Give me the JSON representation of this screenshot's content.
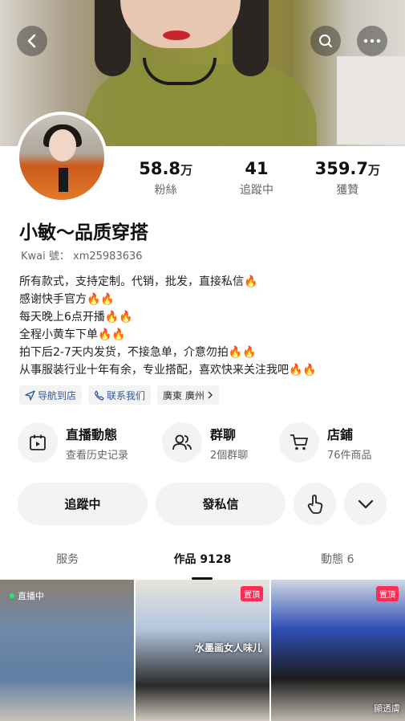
{
  "profile": {
    "name": "小敏～品质穿搭",
    "kwai_id": "Kwai 號： xm25983636",
    "stats": [
      {
        "value": "58.8",
        "unit": "万",
        "label": "粉絲"
      },
      {
        "value": "41",
        "unit": "",
        "label": "追蹤中"
      },
      {
        "value": "359.7",
        "unit": "万",
        "label": "獲贊"
      }
    ],
    "bio": [
      "所有款式，支持定制。代销，批发，直接私信🔥",
      "感谢快手官方🔥🔥",
      "每天晚上6点开播🔥🔥",
      "全程小黄车下单🔥🔥",
      "拍下后2-7天内发货，不接急单，介意勿拍🔥🔥",
      "从事服装行业十年有余，专业搭配，喜欢快来关注我吧🔥🔥"
    ],
    "tags": {
      "navigate": "导航到店",
      "contact": "联系我们",
      "location": "廣東 廣州"
    }
  },
  "features": [
    {
      "title": "直播動態",
      "sub": "查看历史记录",
      "icon": "calendar-icon"
    },
    {
      "title": "群聊",
      "sub": "2個群聊",
      "icon": "group-icon"
    },
    {
      "title": "店鋪",
      "sub": "76件商品",
      "icon": "cart-icon"
    }
  ],
  "actions": {
    "follow": "追蹤中",
    "message": "發私信"
  },
  "tabs": [
    {
      "label": "服务"
    },
    {
      "label": "作品 9128"
    },
    {
      "label": "動態 6"
    }
  ],
  "grid": {
    "live_label": "直播中",
    "pin_label": "置頂",
    "caption": "水墨画女人味儿",
    "watermark": "顯透膚"
  },
  "colors": {
    "accent": "#fe2c55",
    "live": "#2ee56b",
    "link": "#2c5aa0"
  }
}
